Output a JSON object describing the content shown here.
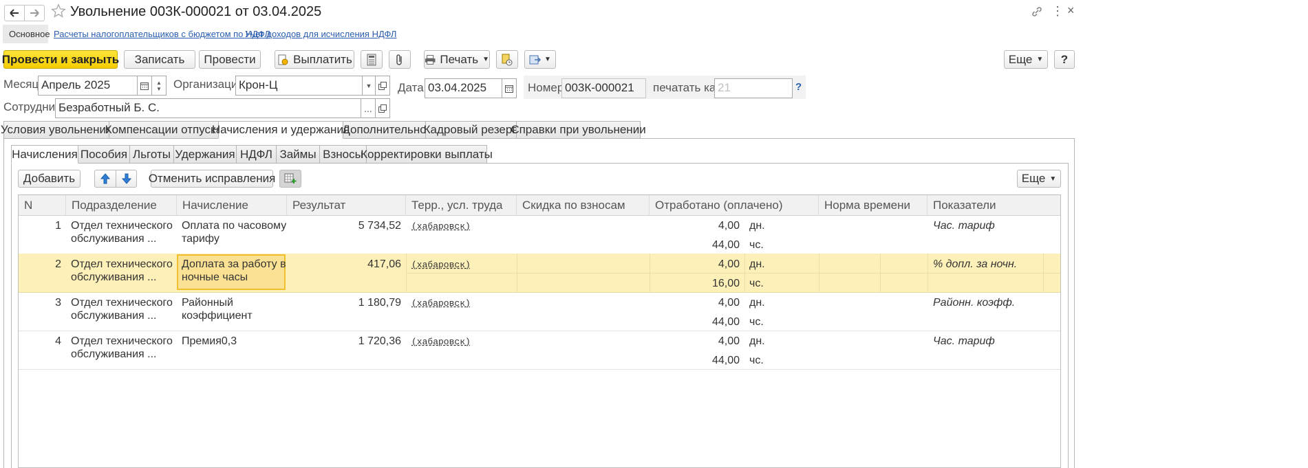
{
  "window": {
    "title": "Увольнение 003К-000021 от 03.04.2025"
  },
  "top_links": [
    {
      "label": "Основное"
    },
    {
      "label": "Расчеты налогоплательщиков с бюджетом по НДФЛ"
    },
    {
      "label": "Учет доходов для исчисления НДФЛ"
    }
  ],
  "toolbar": {
    "post_close": "Провести и закрыть",
    "save": "Записать",
    "post": "Провести",
    "pay": "Выплатить",
    "print": "Печать",
    "more": "Еще",
    "help": "?"
  },
  "form": {
    "month_label": "Месяц:",
    "month_value": "Апрель 2025",
    "org_label": "Организация:",
    "org_value": "Крон-Ц",
    "date_label": "Дата:",
    "date_value": "03.04.2025",
    "number_label": "Номер:",
    "number_value": "003К-000021",
    "print_as_label": "печатать как:",
    "print_as_placeholder": "21",
    "print_as_help": "?",
    "employee_label": "Сотрудник:",
    "employee_value": "Безработный Б. С.",
    "ellipsis": "..."
  },
  "main_tabs": [
    {
      "label": "Условия увольнения"
    },
    {
      "label": "Компенсации отпуска"
    },
    {
      "label": "Начисления и удержания",
      "active": true
    },
    {
      "label": "Дополнительно"
    },
    {
      "label": "Кадровый резерв"
    },
    {
      "label": "Справки при увольнении"
    }
  ],
  "inner_tabs": [
    {
      "label": "Начисления",
      "active": true
    },
    {
      "label": "Пособия"
    },
    {
      "label": "Льготы"
    },
    {
      "label": "Удержания"
    },
    {
      "label": "НДФЛ"
    },
    {
      "label": "Займы"
    },
    {
      "label": "Взносы"
    },
    {
      "label": "Корректировки выплаты"
    }
  ],
  "table_toolbar": {
    "add": "Добавить",
    "cancel_fix": "Отменить исправления",
    "more": "Еще"
  },
  "table": {
    "columns": [
      "N",
      "Подразделение",
      "Начисление",
      "Результат",
      "Терр., усл. труда",
      "Скидка по взносам",
      "Отработано (оплачено)",
      "Норма времени",
      "Показатели"
    ],
    "rows": [
      {
        "n": "1",
        "dept1": "Отдел технического",
        "dept2": "обслуживания ...",
        "acc1": "Оплата по часовому",
        "acc2": "тарифу",
        "result": "5 734,52",
        "terr": "(хабаровск)",
        "days": "4,00",
        "days_unit": "дн.",
        "hours": "44,00",
        "hours_unit": "чс.",
        "indicator": "Час. тариф"
      },
      {
        "n": "2",
        "dept1": "Отдел технического",
        "dept2": "обслуживания ...",
        "acc1": "Доплата за работу в",
        "acc2": "ночные часы",
        "result": "417,06",
        "terr": "(хабаровск)",
        "days": "4,00",
        "days_unit": "дн.",
        "hours": "16,00",
        "hours_unit": "чс.",
        "indicator": "% допл. за ночн."
      },
      {
        "n": "3",
        "dept1": "Отдел технического",
        "dept2": "обслуживания ...",
        "acc1": "Районный",
        "acc2": "коэффициент",
        "result": "1 180,79",
        "terr": "(хабаровск)",
        "days": "4,00",
        "days_unit": "дн.",
        "hours": "44,00",
        "hours_unit": "чс.",
        "indicator": "Районн. коэфф."
      },
      {
        "n": "4",
        "dept1": "Отдел технического",
        "dept2": "обслуживания ...",
        "acc1": "Премия0,3",
        "acc2": "",
        "result": "1 720,36",
        "terr": "(хабаровск)",
        "days": "4,00",
        "days_unit": "дн.",
        "hours": "44,00",
        "hours_unit": "чс.",
        "indicator": "Час. тариф"
      }
    ]
  },
  "colors": {
    "accent_yellow": "#f5cc00",
    "selected_row": "#fdf0b8",
    "selected_cell": "#fbe193",
    "link_blue": "#2a5db0"
  }
}
